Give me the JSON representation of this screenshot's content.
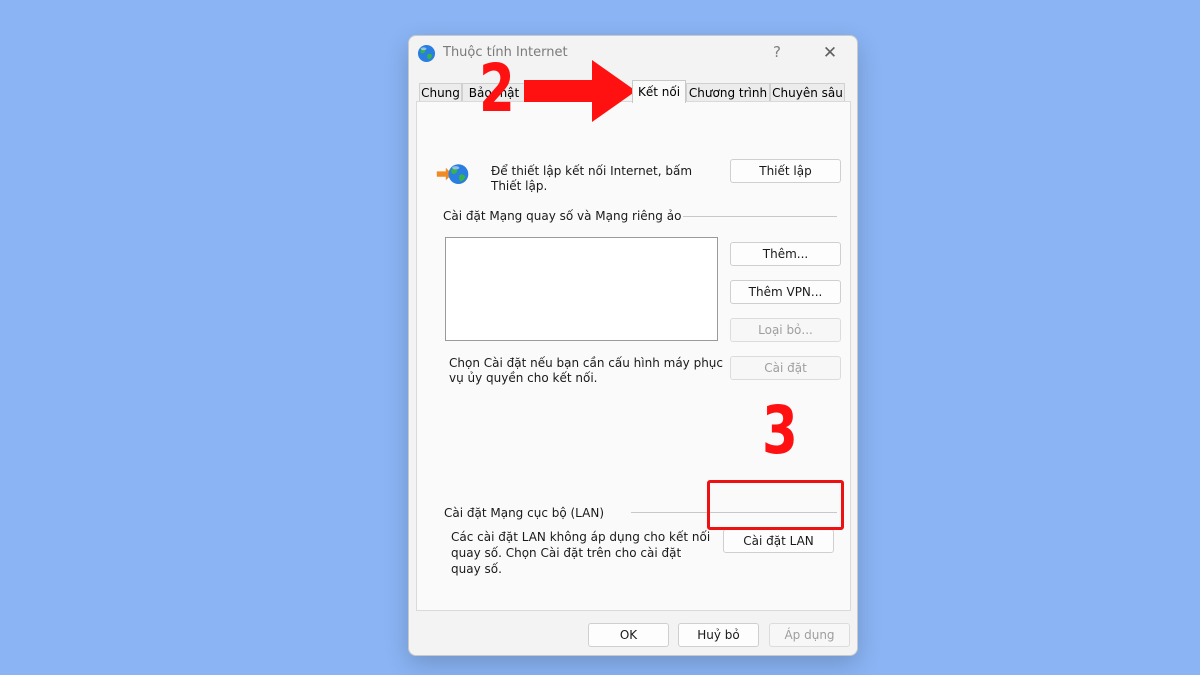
{
  "window": {
    "title": "Thuộc tính Internet",
    "help_glyph": "?",
    "close_glyph": "✕"
  },
  "tabs": [
    {
      "label": "Chung",
      "active": false
    },
    {
      "label": "Bảo mật",
      "active": false
    },
    {
      "label": "Kết nối",
      "active": true
    },
    {
      "label": "Chương trình",
      "active": false
    },
    {
      "label": "Chuyên sâu",
      "active": false
    }
  ],
  "setup_section": {
    "text_line1": "Để thiết lập kết nối Internet, bấm",
    "text_line2": "Thiết lập.",
    "setup_button": "Thiết lập"
  },
  "dialup_section": {
    "heading": "Cài đặt Mạng quay số và Mạng riêng ảo",
    "add_button": "Thêm...",
    "add_vpn_button": "Thêm VPN...",
    "remove_button": "Loại bỏ...",
    "settings_button": "Cài đặt",
    "note_line1": "Chọn Cài đặt nếu bạn cần cấu hình máy phục",
    "note_line2": "vụ ủy quyền cho kết nối."
  },
  "lan_section": {
    "heading": "Cài đặt Mạng cục bộ (LAN)",
    "text_line1": "Các cài đặt LAN không áp dụng cho kết nối",
    "text_line2": "quay số. Chọn Cài đặt trên cho cài đặt",
    "text_line3": "quay số.",
    "lan_button": "Cài đặt LAN"
  },
  "footer": {
    "ok": "OK",
    "cancel": "Huỷ bỏ",
    "apply": "Áp dụng"
  },
  "annotations": {
    "step2": "2",
    "step3": "3",
    "color": "#ff1111"
  },
  "icons": {
    "app": "globe-icon",
    "connect": "globe-arrow-icon"
  }
}
